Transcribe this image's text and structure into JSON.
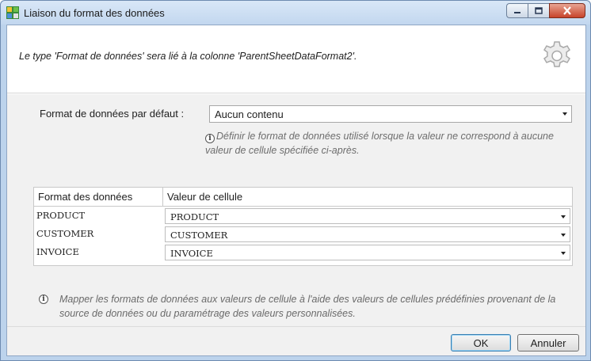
{
  "window": {
    "title": "Liaison du format des données"
  },
  "header": {
    "message": "Le type 'Format de données' sera lié à la colonne 'ParentSheetDataFormat2'."
  },
  "default_format": {
    "label": "Format de données par défaut :",
    "selected": "Aucun contenu",
    "hint": "Définir le format de données utilisé lorsque la valeur ne correspond à aucune valeur de cellule spécifiée ci-après."
  },
  "grid": {
    "columns": [
      "Format des données",
      "Valeur de cellule"
    ],
    "rows": [
      {
        "format": "PRODUCT",
        "value": "PRODUCT"
      },
      {
        "format": "CUSTOMER",
        "value": "CUSTOMER"
      },
      {
        "format": "INVOICE",
        "value": "INVOICE"
      }
    ]
  },
  "note": "Mapper les formats de données aux valeurs de cellule à l'aide des valeurs de cellules prédéfinies provenant de la source de données ou du paramétrage des valeurs personnalisées.",
  "buttons": {
    "ok": "OK",
    "cancel": "Annuler"
  },
  "icons": {
    "app": "app-icon",
    "gear": "gear-icon",
    "info": "info-icon",
    "minimize": "minimize-icon",
    "maximize": "maximize-icon",
    "close": "close-icon"
  },
  "colors": {
    "titlebar": "#c2d7ef",
    "close_button": "#c7432a",
    "panel_bg": "#f1f1f1",
    "hint_text": "#6d6d6d"
  }
}
